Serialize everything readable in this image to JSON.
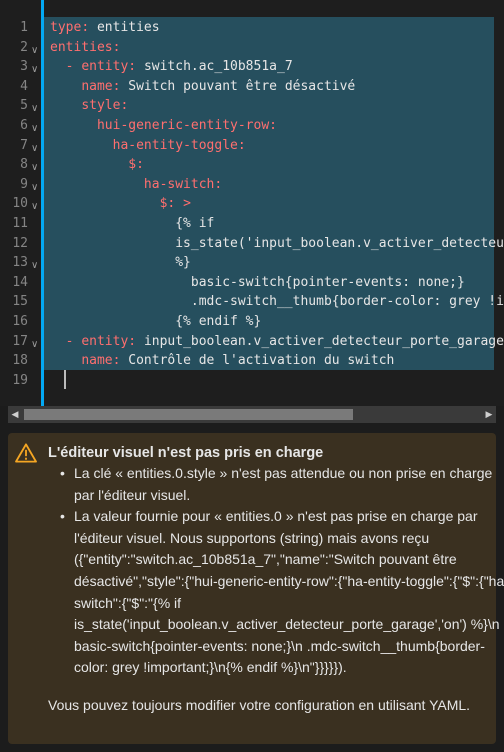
{
  "editor": {
    "lines": [
      {
        "n": "1",
        "fold": false,
        "ind": "",
        "key": "type",
        "sep": ": ",
        "val": "entities"
      },
      {
        "n": "2",
        "fold": true,
        "ind": "",
        "key": "entities",
        "sep": ":",
        "val": ""
      },
      {
        "n": "3",
        "fold": true,
        "ind": "  - ",
        "key": "entity",
        "sep": ": ",
        "val": "switch.ac_10b851a_7"
      },
      {
        "n": "4",
        "fold": false,
        "ind": "    ",
        "key": "name",
        "sep": ": ",
        "val": "Switch pouvant être désactivé"
      },
      {
        "n": "5",
        "fold": true,
        "ind": "    ",
        "key": "style",
        "sep": ":",
        "val": ""
      },
      {
        "n": "6",
        "fold": true,
        "ind": "      ",
        "key": "hui-generic-entity-row",
        "sep": ":",
        "val": ""
      },
      {
        "n": "7",
        "fold": true,
        "ind": "        ",
        "key": "ha-entity-toggle",
        "sep": ":",
        "val": ""
      },
      {
        "n": "8",
        "fold": true,
        "ind": "          ",
        "key": "$",
        "sep": ":",
        "val": ""
      },
      {
        "n": "9",
        "fold": true,
        "ind": "            ",
        "key": "ha-switch",
        "sep": ":",
        "val": ""
      },
      {
        "n": "10",
        "fold": true,
        "ind": "              ",
        "key": "$",
        "sep": ": ",
        "val": ">"
      },
      {
        "n": "11",
        "fold": false,
        "ind": "                ",
        "key": "",
        "sep": "",
        "val": "{% if"
      },
      {
        "n": "12",
        "fold": false,
        "ind": "                ",
        "key": "",
        "sep": "",
        "val": "is_state('input_boolean.v_activer_detecteur_porte_garage','on')"
      },
      {
        "n": "13",
        "fold": true,
        "ind": "                ",
        "key": "",
        "sep": "",
        "val": "%}"
      },
      {
        "n": "14",
        "fold": false,
        "ind": "                  ",
        "key": "",
        "sep": "",
        "val": "basic-switch{pointer-events: none;}"
      },
      {
        "n": "15",
        "fold": false,
        "ind": "                  ",
        "key": "",
        "sep": "",
        "val": ".mdc-switch__thumb{border-color: grey !important;}"
      },
      {
        "n": "16",
        "fold": false,
        "ind": "                ",
        "key": "",
        "sep": "",
        "val": "{% endif %}"
      },
      {
        "n": "17",
        "fold": true,
        "ind": "  - ",
        "key": "entity",
        "sep": ": ",
        "val": "input_boolean.v_activer_detecteur_porte_garage"
      },
      {
        "n": "18",
        "fold": false,
        "ind": "    ",
        "key": "name",
        "sep": ": ",
        "val": "Contrôle de l'activation du switch"
      },
      {
        "n": "19",
        "fold": false,
        "ind": "",
        "key": "",
        "sep": "",
        "val": ""
      }
    ],
    "scroll_left_glyph": "◀",
    "scroll_right_glyph": "▶"
  },
  "warning": {
    "icon": "warning-triangle-icon",
    "color": "#f5a623",
    "title": "L'éditeur visuel n'est pas pris en charge",
    "items": [
      "La clé « entities.0.style » n'est pas attendue ou non prise en charge par l'éditeur visuel.",
      "La valeur fournie pour « entities.0 » n'est pas prise en charge par l'éditeur visuel. Nous supportons (string) mais avons reçu ({\"entity\":\"switch.ac_10b851a_7\",\"name\":\"Switch pouvant être désactivé\",\"style\":{\"hui-generic-entity-row\":{\"ha-entity-toggle\":{\"$\":{\"ha-switch\":{\"$\":\"{% if is_state('input_boolean.v_activer_detecteur_porte_garage','on') %}\\n basic-switch{pointer-events: none;}\\n .mdc-switch__thumb{border-color: grey !important;}\\n{% endif %}\\n\"}}}}})."
    ],
    "footer": "Vous pouvez toujours modifier votre configuration en utilisant YAML."
  }
}
